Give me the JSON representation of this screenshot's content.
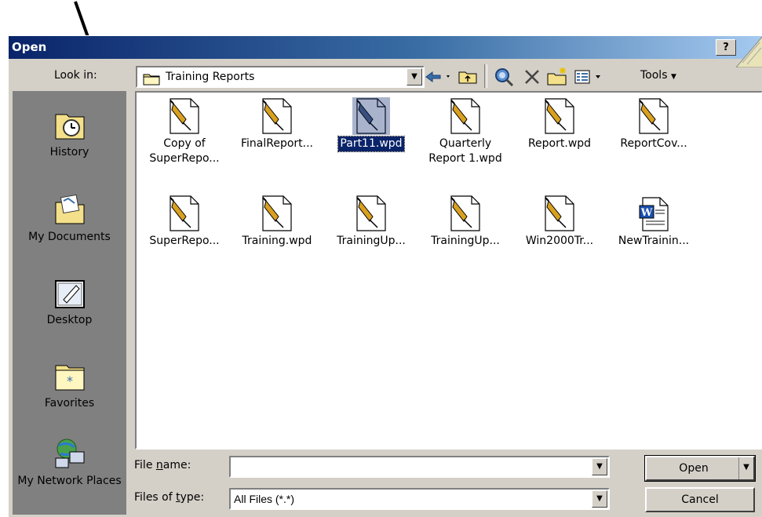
{
  "window": {
    "title": "Open",
    "help_label": "?"
  },
  "toolbar": {
    "look_in_label": "Look in:",
    "look_in_value": "Training Reports",
    "tools_label": "Tools",
    "buttons": [
      "back-icon",
      "up-folder-icon",
      "search-web-icon",
      "delete-icon",
      "new-folder-icon",
      "views-icon"
    ]
  },
  "places": [
    {
      "label": "History",
      "icon": "history-icon"
    },
    {
      "label": "My Documents",
      "icon": "my-documents-icon"
    },
    {
      "label": "Desktop",
      "icon": "desktop-icon"
    },
    {
      "label": "Favorites",
      "icon": "favorites-icon"
    },
    {
      "label": "My Network Places",
      "icon": "network-places-icon"
    }
  ],
  "files": [
    {
      "name": "Copy of SuperRepo...",
      "icon": "wordperfect-doc-icon",
      "selected": false
    },
    {
      "name": "FinalReport...",
      "icon": "wordperfect-doc-icon",
      "selected": false
    },
    {
      "name": "Part11.wpd",
      "icon": "wordperfect-doc-icon",
      "selected": true
    },
    {
      "name": "Quarterly Report 1.wpd",
      "icon": "wordperfect-doc-icon",
      "selected": false
    },
    {
      "name": "Report.wpd",
      "icon": "wordperfect-doc-icon",
      "selected": false
    },
    {
      "name": "ReportCov...",
      "icon": "wordperfect-doc-icon",
      "selected": false
    },
    {
      "name": "SuperRepo...",
      "icon": "wordperfect-doc-icon",
      "selected": false
    },
    {
      "name": "Training.wpd",
      "icon": "wordperfect-doc-icon",
      "selected": false
    },
    {
      "name": "TrainingUp...",
      "icon": "wordperfect-doc-icon",
      "selected": false
    },
    {
      "name": "TrainingUp...",
      "icon": "wordperfect-doc-icon",
      "selected": false
    },
    {
      "name": "Win2000Tr...",
      "icon": "wordperfect-doc-icon",
      "selected": false
    },
    {
      "name": "NewTrainin...",
      "icon": "word-doc-icon",
      "selected": false
    }
  ],
  "file_name": {
    "label": "File name:",
    "value": ""
  },
  "file_type": {
    "label": "Files of type:",
    "value": "All Files (*.*)"
  },
  "actions": {
    "open_label": "Open",
    "cancel_label": "Cancel"
  },
  "colors": {
    "titlebar_start": "#0a246a",
    "titlebar_end": "#a6caf0",
    "dialog_face": "#d4d0c8",
    "places_bar": "#808080",
    "selection": "#0a246a"
  }
}
